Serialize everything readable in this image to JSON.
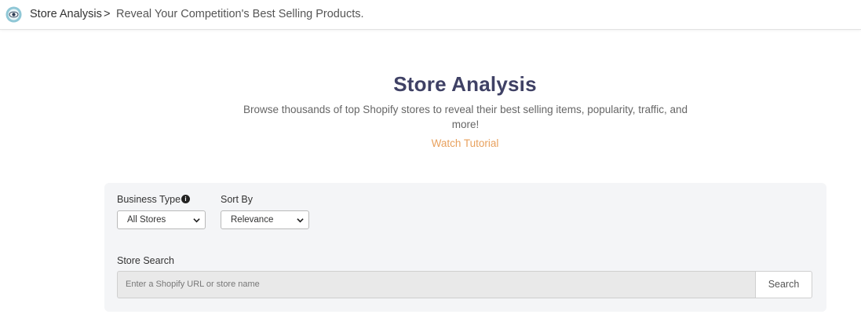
{
  "breadcrumb": {
    "title": "Store Analysis",
    "separator": ">",
    "subtitle": "Reveal Your Competition's Best Selling Products."
  },
  "hero": {
    "title": "Store Analysis",
    "description": "Browse thousands of top Shopify stores to reveal their best selling items, popularity, traffic, and more!",
    "tutorial_link": "Watch Tutorial"
  },
  "filters": {
    "business_type": {
      "label": "Business Type",
      "selected": "All Stores"
    },
    "sort_by": {
      "label": "Sort By",
      "selected": "Relevance"
    }
  },
  "store_search": {
    "label": "Store Search",
    "placeholder": "Enter a Shopify URL or store name",
    "button_label": "Search"
  },
  "colors": {
    "title": "#3f4165",
    "accent_link": "#e8a15e",
    "panel_bg": "#f4f5f7",
    "logo_ring": "#8fc7d6"
  },
  "icons": {
    "logo": "eye-logo-icon",
    "info": "info-icon",
    "dropdown": "chevron-down-icon"
  }
}
